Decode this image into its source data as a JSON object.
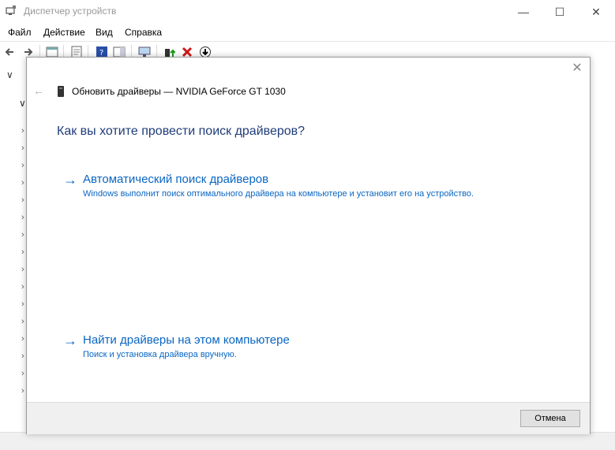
{
  "window": {
    "title": "Диспетчер устройств",
    "controls": {
      "minimize": "—",
      "maximize": "☐",
      "close": "✕"
    }
  },
  "menu": {
    "items": [
      "Файл",
      "Действие",
      "Вид",
      "Справка"
    ]
  },
  "dialog": {
    "heading": "Обновить драйверы — NVIDIA GeForce GT 1030",
    "question": "Как вы хотите провести поиск драйверов?",
    "options": [
      {
        "title": "Автоматический поиск драйверов",
        "description": "Windows выполнит поиск оптимального драйвера на компьютере и установит его на устройство."
      },
      {
        "title": "Найти драйверы на этом компьютере",
        "description": "Поиск и установка драйвера вручную."
      }
    ],
    "cancel_label": "Отмена",
    "arrow": "→"
  },
  "colors": {
    "link": "#0a66c2",
    "question": "#1f3c7a"
  }
}
